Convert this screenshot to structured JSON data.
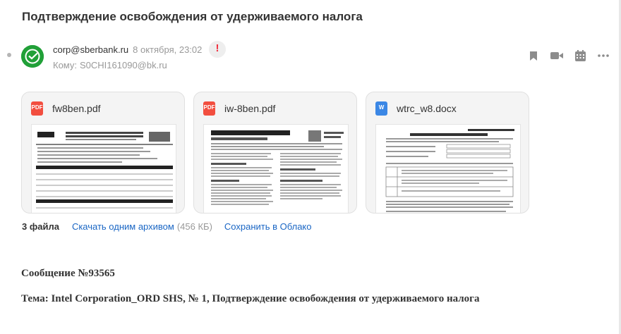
{
  "subject": "Подтверждение освобождения от удерживаемого налога",
  "sender": {
    "email": "corp@sberbank.ru",
    "date": "8 октября, 23:02",
    "to_label": "Кому:",
    "to_value": "S0CHI161090@bk.ru",
    "important_mark": "!"
  },
  "toolbar_icons": [
    "bookmark-icon",
    "video-icon",
    "calendar-icon",
    "more-icon"
  ],
  "attachments": [
    {
      "name": "fw8ben.pdf",
      "type": "pdf",
      "icon_label": "PDF"
    },
    {
      "name": "iw-8ben.pdf",
      "type": "pdf",
      "icon_label": "PDF"
    },
    {
      "name": "wtrc_w8.docx",
      "type": "docx",
      "icon_label": "W"
    }
  ],
  "attachments_footer": {
    "count": "3 файла",
    "download_all": "Скачать одним архивом",
    "size": "(456 КБ)",
    "save_cloud": "Сохранить в Облако"
  },
  "body": {
    "message_number": "Сообщение №93565",
    "topic": "Тема: Intel Corporation_ORD SHS, № 1, Подтверждение освобождения от удерживаемого налога"
  },
  "colors": {
    "link": "#1a66c4",
    "sber_green": "#21a038",
    "pdf_red": "#f24e3f",
    "doc_blue": "#3b87e5",
    "important_red": "#f0303f"
  }
}
